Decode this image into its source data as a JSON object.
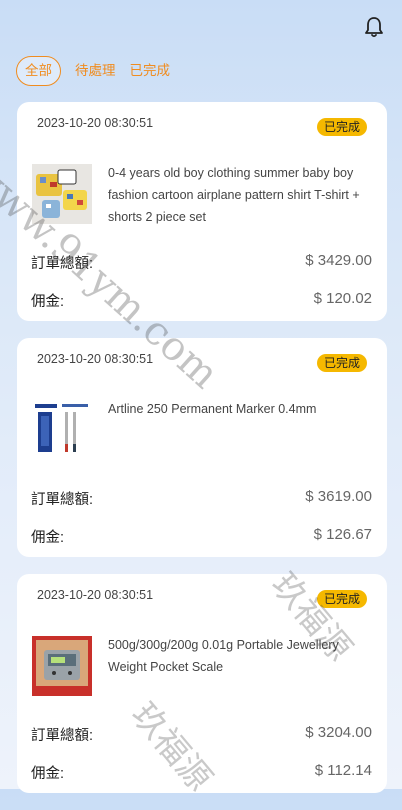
{
  "tabs": [
    {
      "label": "全部",
      "active": true
    },
    {
      "label": "待處理",
      "active": false
    },
    {
      "label": "已完成",
      "active": false
    }
  ],
  "orders": [
    {
      "date": "2023-10-20 08:30:51",
      "status": "已完成",
      "title": "0-4 years old boy clothing summer baby boy fashion cartoon airplane pattern shirt T-shirt + shorts 2 piece set",
      "thumb_icon": "baby-clothing-product-image",
      "total_label": "訂單總額:",
      "total_value": "$ 3429.00",
      "commission_label": "佣金:",
      "commission_value": "$ 120.02"
    },
    {
      "date": "2023-10-20 08:30:51",
      "status": "已完成",
      "title": "Artline 250 Permanent Marker 0.4mm",
      "thumb_icon": "marker-product-image",
      "total_label": "訂單總額:",
      "total_value": "$ 3619.00",
      "commission_label": "佣金:",
      "commission_value": "$ 126.67"
    },
    {
      "date": "2023-10-20 08:30:51",
      "status": "已完成",
      "title": "500g/300g/200g 0.01g Portable Jewellery Weight Pocket Scale",
      "thumb_icon": "pocket-scale-product-image",
      "total_label": "訂單總額:",
      "total_value": "$ 3204.00",
      "commission_label": "佣金:",
      "commission_value": "$ 112.14"
    }
  ],
  "watermark": {
    "url_text": "www.91ym.com",
    "cjk_text": "玖福源"
  },
  "colors": {
    "accent": "#f08c1f",
    "status_badge": "#f5b800"
  }
}
